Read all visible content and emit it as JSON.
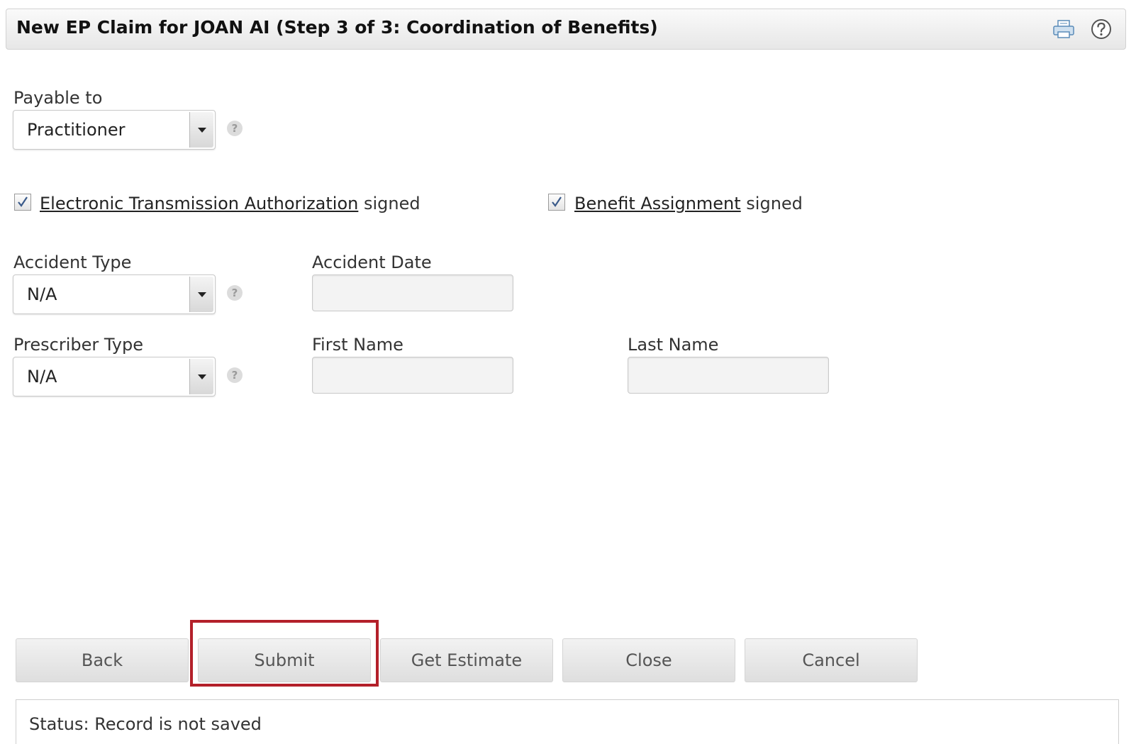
{
  "header": {
    "title": "New EP Claim for JOAN AI (Step 3 of 3: Coordination of Benefits)",
    "print_icon": "printer-icon",
    "help_icon": "help-circle-icon"
  },
  "payable_to": {
    "label": "Payable to",
    "value": "Practitioner"
  },
  "authorizations": {
    "eta_link": "Electronic Transmission Authorization",
    "eta_suffix": " signed",
    "eta_checked": true,
    "benefit_link": "Benefit Assignment",
    "benefit_suffix": " signed",
    "benefit_checked": true
  },
  "accident": {
    "type_label": "Accident Type",
    "type_value": "N/A",
    "date_label": "Accident Date",
    "date_value": ""
  },
  "prescriber": {
    "type_label": "Prescriber Type",
    "type_value": "N/A",
    "first_name_label": "First Name",
    "first_name_value": "",
    "last_name_label": "Last Name",
    "last_name_value": ""
  },
  "help_glyph": "?",
  "buttons": {
    "back": "Back",
    "submit": "Submit",
    "estimate": "Get Estimate",
    "close": "Close",
    "cancel": "Cancel"
  },
  "status": {
    "text": "Status: Record is not saved"
  },
  "colors": {
    "highlight": "#b3202a"
  }
}
